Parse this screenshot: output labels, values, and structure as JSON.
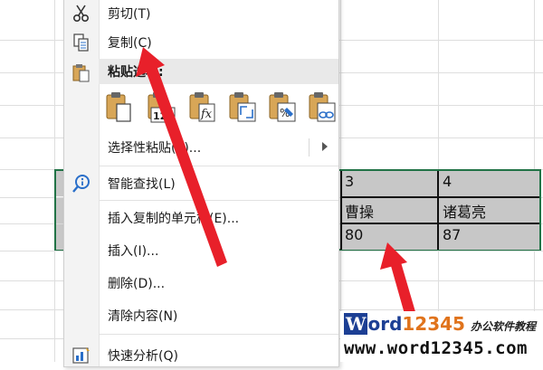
{
  "menu": {
    "items": [
      {
        "label": "剪切(T)",
        "icon": "scissors-icon"
      },
      {
        "label": "复制(C)",
        "icon": "copy-icon"
      },
      {
        "label": "选择性粘贴(S)...",
        "icon": ""
      },
      {
        "label": "智能查找(L)",
        "icon": "smart-lookup-icon"
      },
      {
        "label": "插入复制的单元格(E)...",
        "icon": ""
      },
      {
        "label": "插入(I)...",
        "icon": ""
      },
      {
        "label": "删除(D)...",
        "icon": ""
      },
      {
        "label": "清除内容(N)",
        "icon": ""
      },
      {
        "label": "快速分析(Q)",
        "icon": "quick-analysis-icon"
      }
    ],
    "paste_header": "粘贴选项:",
    "paste_options": [
      "paste-icon",
      "paste-values-icon",
      "paste-formulas-icon",
      "paste-transpose-icon",
      "paste-formatting-icon",
      "paste-link-icon"
    ]
  },
  "cells": {
    "r1": [
      "3",
      "4"
    ],
    "r2": [
      "曹操",
      "诸葛亮"
    ],
    "r3": [
      "80",
      "87"
    ]
  },
  "watermark": {
    "brand_w": "W",
    "brand_ord": "ord",
    "brand_num": "12345",
    "sub": "办公软件教程",
    "url": "www.word12345.com"
  },
  "colors": {
    "selection_border": "#217346",
    "cell_fill": "#c7c7c7",
    "arrow": "#e8202a",
    "brand_blue": "#1c3f94",
    "brand_orange": "#e0731c"
  }
}
